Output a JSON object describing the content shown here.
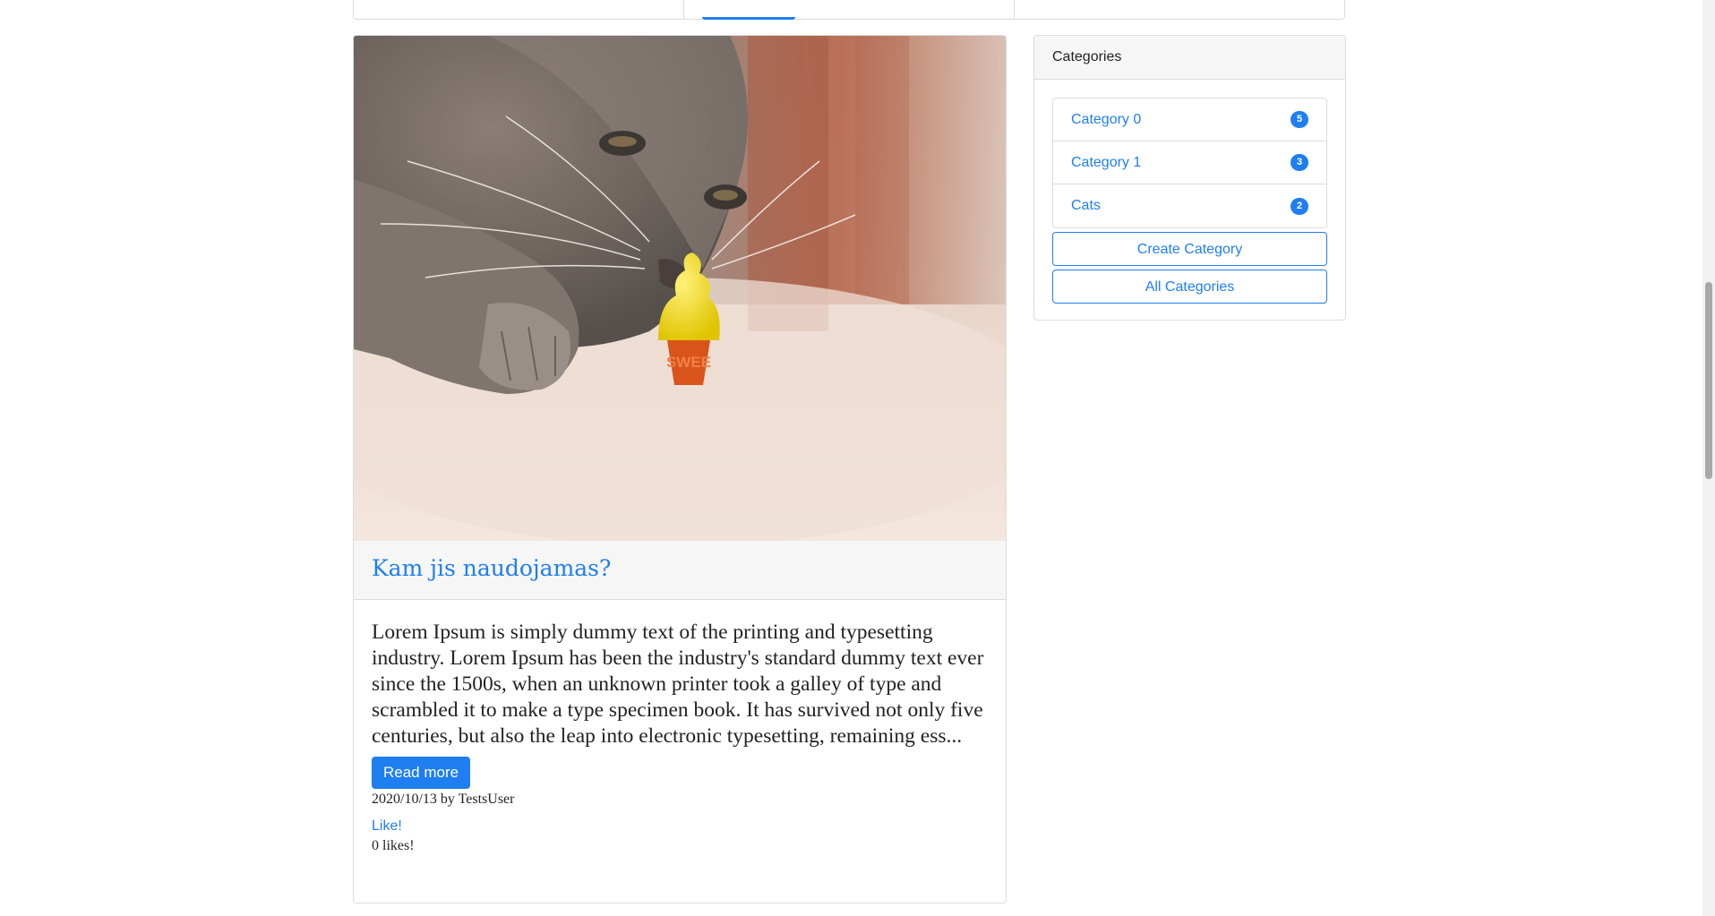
{
  "post": {
    "image_alt": "cat sniffing a toy ice cream cone",
    "image_toy_text": "SWEE",
    "title": "Kam jis naudojamas?",
    "excerpt": "Lorem Ipsum is simply dummy text of the printing and typesetting industry. Lorem Ipsum has been the industry's standard dummy text ever since the 1500s, when an unknown printer took a galley of type and scrambled it to make a type specimen book. It has survived not only five centuries, but also the leap into electronic typesetting, remaining ess...",
    "read_more_label": "Read more",
    "meta": "2020/10/13 by TestsUser",
    "like_label": "Like!",
    "likes_text": "0 likes!"
  },
  "categories": {
    "header": "Categories",
    "items": [
      {
        "name": "Category 0",
        "count": "5"
      },
      {
        "name": "Category 1",
        "count": "3"
      },
      {
        "name": "Cats",
        "count": "2"
      }
    ],
    "create_label": "Create Category",
    "all_label": "All Categories"
  },
  "colors": {
    "accent": "#1f7ef0",
    "border": "#dcdcdc",
    "header_bg": "#f6f6f6"
  }
}
